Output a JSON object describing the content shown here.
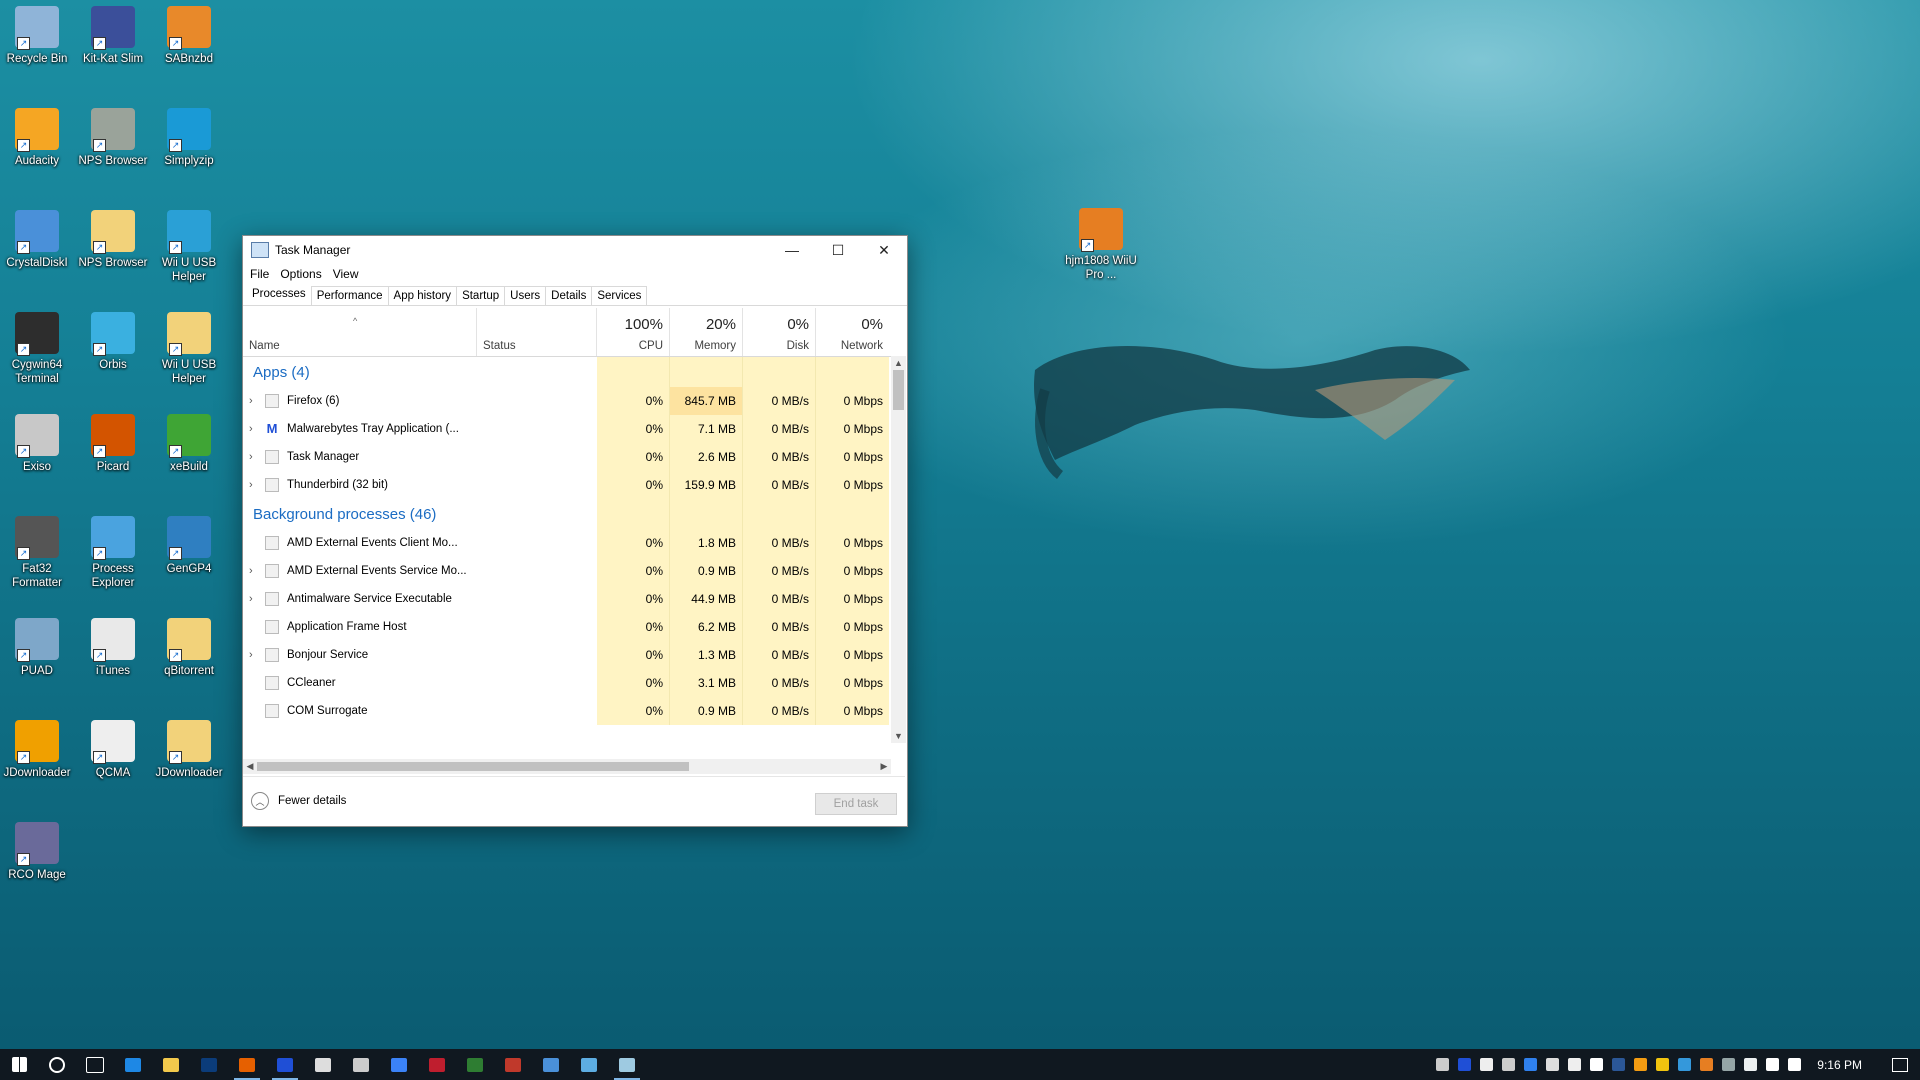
{
  "desktop": {
    "icons": [
      {
        "label": "Recycle Bin",
        "color": "#8fb4d8"
      },
      {
        "label": "Kit-Kat Slim",
        "color": "#3b4f9a"
      },
      {
        "label": "SABnzbd",
        "color": "#e8892a"
      },
      {
        "label": "Audacity",
        "color": "#f5a623"
      },
      {
        "label": "NPS Browser",
        "color": "#9aa39a"
      },
      {
        "label": "Simplyzip",
        "color": "#1a9ad6"
      },
      {
        "label": "CrystalDiskI",
        "color": "#4a90d9"
      },
      {
        "label": "NPS Browser",
        "color": "#f2d27a"
      },
      {
        "label": "Wii U USB Helper",
        "color": "#2aa0d6"
      },
      {
        "label": "Cygwin64 Terminal",
        "color": "#2d2d2d"
      },
      {
        "label": "Orbis",
        "color": "#3ab0e0"
      },
      {
        "label": "Wii U USB Helper",
        "color": "#f2d27a"
      },
      {
        "label": "Exiso",
        "color": "#c8c8c8"
      },
      {
        "label": "Picard",
        "color": "#d35400"
      },
      {
        "label": "xeBuild",
        "color": "#3fa535"
      },
      {
        "label": "Fat32 Formatter",
        "color": "#555555"
      },
      {
        "label": "Process Explorer",
        "color": "#4aa3df"
      },
      {
        "label": "GenGP4",
        "color": "#2f7fc1"
      },
      {
        "label": "PUAD",
        "color": "#7ea7c9"
      },
      {
        "label": "iTunes",
        "color": "#e9e9e9"
      },
      {
        "label": "qBitorrent",
        "color": "#f2d27a"
      },
      {
        "label": "JDownloader",
        "color": "#f0a000"
      },
      {
        "label": "QCMA",
        "color": "#eeeeee"
      },
      {
        "label": "JDownloader",
        "color": "#f2d27a"
      },
      {
        "label": "RCO Mage",
        "color": "#6a6a9a"
      },
      {
        "label": "hjm1808 WiiU Pro ...",
        "color": "#e67e22"
      }
    ]
  },
  "window": {
    "title": "Task Manager",
    "controls": {
      "minimize": "—",
      "maximize": "☐",
      "close": "✕"
    },
    "menu": [
      "File",
      "Options",
      "View"
    ],
    "tabs": [
      "Processes",
      "Performance",
      "App history",
      "Startup",
      "Users",
      "Details",
      "Services"
    ],
    "active_tab": "Processes",
    "columns": {
      "name": "Name",
      "status": "Status",
      "cpu": {
        "pct": "100%",
        "label": "CPU"
      },
      "memory": {
        "pct": "20%",
        "label": "Memory"
      },
      "disk": {
        "pct": "0%",
        "label": "Disk"
      },
      "network": {
        "pct": "0%",
        "label": "Network"
      }
    },
    "groups": [
      {
        "label": "Apps (4)",
        "rows": [
          {
            "name": "Firefox (6)",
            "cpu": "0%",
            "mem": "845.7 MB",
            "disk": "0 MB/s",
            "net": "0 Mbps",
            "expand": "›"
          },
          {
            "name": "Malwarebytes Tray Application (...",
            "cpu": "0%",
            "mem": "7.1 MB",
            "disk": "0 MB/s",
            "net": "0 Mbps",
            "expand": "›"
          },
          {
            "name": "Task Manager",
            "cpu": "0%",
            "mem": "2.6 MB",
            "disk": "0 MB/s",
            "net": "0 Mbps",
            "expand": "›"
          },
          {
            "name": "Thunderbird (32 bit)",
            "cpu": "0%",
            "mem": "159.9 MB",
            "disk": "0 MB/s",
            "net": "0 Mbps",
            "expand": "›"
          }
        ]
      },
      {
        "label": "Background processes (46)",
        "rows": [
          {
            "name": "AMD External Events Client Mo...",
            "cpu": "0%",
            "mem": "1.8 MB",
            "disk": "0 MB/s",
            "net": "0 Mbps",
            "expand": ""
          },
          {
            "name": "AMD External Events Service Mo...",
            "cpu": "0%",
            "mem": "0.9 MB",
            "disk": "0 MB/s",
            "net": "0 Mbps",
            "expand": "›"
          },
          {
            "name": "Antimalware Service Executable",
            "cpu": "0%",
            "mem": "44.9 MB",
            "disk": "0 MB/s",
            "net": "0 Mbps",
            "expand": "›"
          },
          {
            "name": "Application Frame Host",
            "cpu": "0%",
            "mem": "6.2 MB",
            "disk": "0 MB/s",
            "net": "0 Mbps",
            "expand": ""
          },
          {
            "name": "Bonjour Service",
            "cpu": "0%",
            "mem": "1.3 MB",
            "disk": "0 MB/s",
            "net": "0 Mbps",
            "expand": "›"
          },
          {
            "name": "CCleaner",
            "cpu": "0%",
            "mem": "3.1 MB",
            "disk": "0 MB/s",
            "net": "0 Mbps",
            "expand": ""
          },
          {
            "name": "COM Surrogate",
            "cpu": "0%",
            "mem": "0.9 MB",
            "disk": "0 MB/s",
            "net": "0 Mbps",
            "expand": ""
          }
        ]
      }
    ],
    "footer": {
      "fewer_details": "Fewer details",
      "end_task": "End task"
    }
  },
  "taskbar": {
    "items": [
      {
        "name": "start-button",
        "color": "#ffffff"
      },
      {
        "name": "cortana-button",
        "color": "#ffffff"
      },
      {
        "name": "task-view-button",
        "color": "#ffffff"
      },
      {
        "name": "edge-icon",
        "color": "#1e88e5"
      },
      {
        "name": "file-explorer-icon",
        "color": "#f2c94c"
      },
      {
        "name": "photoshop-icon",
        "color": "#0b3c7a"
      },
      {
        "name": "firefox-icon",
        "color": "#e66000"
      },
      {
        "name": "malwarebytes-icon",
        "color": "#1f4fd6"
      },
      {
        "name": "chrome-icon",
        "color": "#dddddd"
      },
      {
        "name": "shield-icon",
        "color": "#cccccc"
      },
      {
        "name": "app-window-icon",
        "color": "#3b82f6"
      },
      {
        "name": "filezilla-icon",
        "color": "#bf1e2e"
      },
      {
        "name": "terminal-icon",
        "color": "#2e7d32"
      },
      {
        "name": "image-tool-icon",
        "color": "#c0392b"
      },
      {
        "name": "remote-desktop-icon",
        "color": "#4a90d9"
      },
      {
        "name": "monitor-icon",
        "color": "#5dade2"
      },
      {
        "name": "task-manager-icon",
        "color": "#9ecae1"
      }
    ],
    "tray_colors": [
      "#cccccc",
      "#1f4fd6",
      "#eeeeee",
      "#cccccc",
      "#2f80ed",
      "#dddddd",
      "#eeeeee",
      "#ffffff",
      "#2b5797",
      "#f39c12",
      "#f1c40f",
      "#3498db",
      "#e67e22",
      "#95a5a6",
      "#ecf0f1",
      "#ffffff",
      "#ffffff"
    ],
    "time": "9:16 PM"
  }
}
